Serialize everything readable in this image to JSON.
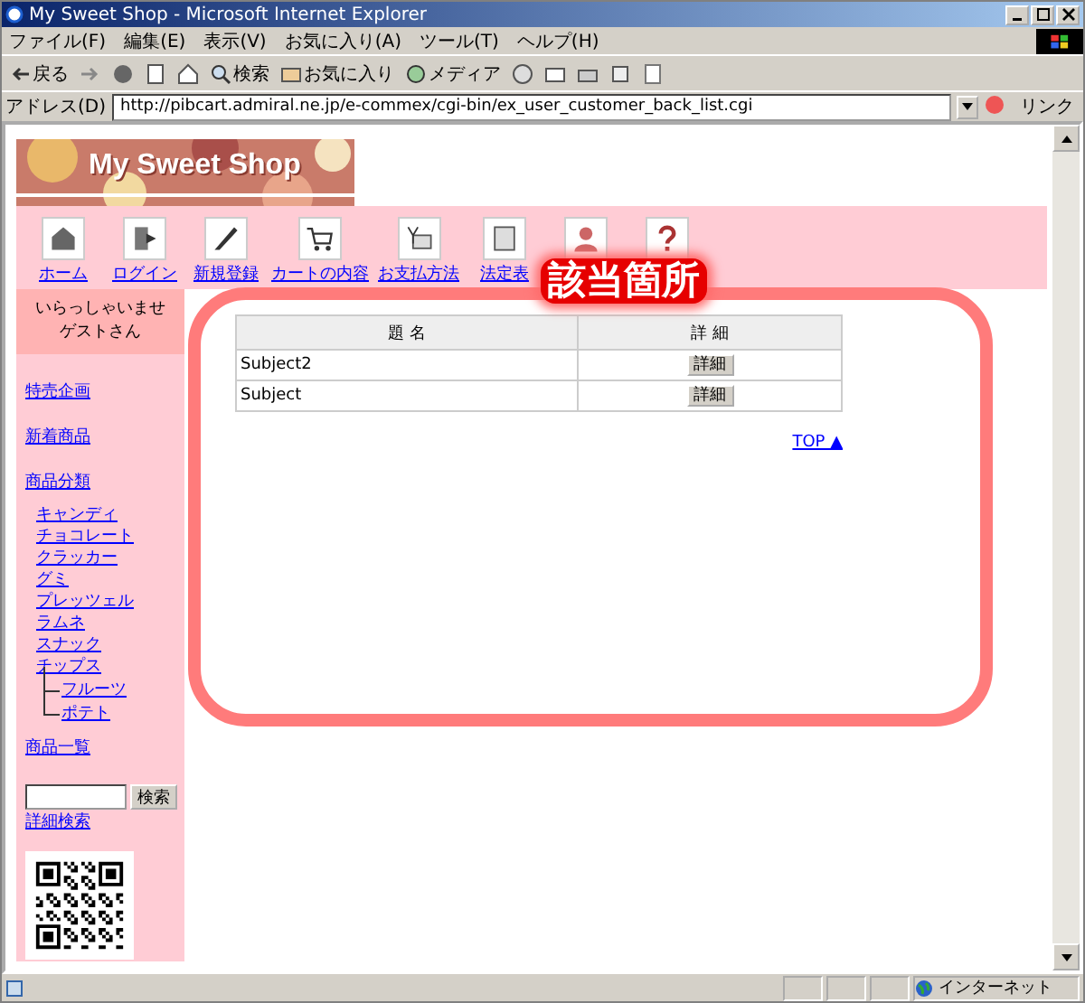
{
  "window": {
    "title": "My Sweet Shop - Microsoft Internet Explorer"
  },
  "menu": [
    "ファイル(F)",
    "編集(E)",
    "表示(V)",
    "お気に入り(A)",
    "ツール(T)",
    "ヘルプ(H)"
  ],
  "toolbar": [
    {
      "kind": "back",
      "label": "戻る"
    },
    {
      "kind": "forward"
    },
    {
      "kind": "stop"
    },
    {
      "kind": "refresh"
    },
    {
      "kind": "home"
    },
    {
      "kind": "search",
      "label": "検索"
    },
    {
      "kind": "favorites",
      "label": "お気に入り"
    },
    {
      "kind": "media",
      "label": "メディア"
    },
    {
      "kind": "history"
    },
    {
      "kind": "mail"
    },
    {
      "kind": "print"
    },
    {
      "kind": "edit"
    },
    {
      "kind": "discuss"
    }
  ],
  "address": {
    "label": "アドレス(D)",
    "value": "http://pibcart.admiral.ne.jp/e-commex/cgi-bin/ex_user_customer_back_list.cgi",
    "links": "リンク"
  },
  "page": {
    "banner": {
      "title": "My Sweet Shop"
    },
    "nav": [
      {
        "kind": "home",
        "label": "ホーム"
      },
      {
        "kind": "login",
        "label": "ログイン"
      },
      {
        "kind": "pen",
        "label": "新規登録"
      },
      {
        "kind": "cart",
        "label": "カートの内容"
      },
      {
        "kind": "pay",
        "label": "お支払方法"
      },
      {
        "kind": "doc",
        "label": "法定表"
      },
      {
        "kind": "person"
      },
      {
        "kind": "help"
      }
    ],
    "greeting": [
      "いらっしゃいませ",
      "ゲストさん"
    ],
    "sidebar": [
      {
        "label": "特売企画"
      },
      {
        "label": "新着商品"
      },
      {
        "label": "商品分類",
        "children": [
          {
            "label": "キャンディ"
          },
          {
            "label": "チョコレート"
          },
          {
            "label": "クラッカー"
          },
          {
            "label": "グミ"
          },
          {
            "label": "プレッツェル"
          },
          {
            "label": "ラムネ"
          },
          {
            "label": "スナック"
          },
          {
            "label": "チップス",
            "children": [
              {
                "label": "フルーツ"
              },
              {
                "label": "ポテト"
              }
            ]
          }
        ]
      },
      {
        "label": "商品一覧"
      }
    ],
    "search": {
      "button": "検索",
      "advanced": "詳細検索"
    },
    "table": {
      "columns": [
        "題 名",
        "詳 細"
      ],
      "rows": [
        {
          "subject": "Subject2",
          "button": "詳細"
        },
        {
          "subject": "Subject",
          "button": "詳細"
        }
      ]
    },
    "top_link": "TOP ▲",
    "callout": "該当箇所"
  },
  "status_bar": {
    "zone": "インターネット"
  }
}
